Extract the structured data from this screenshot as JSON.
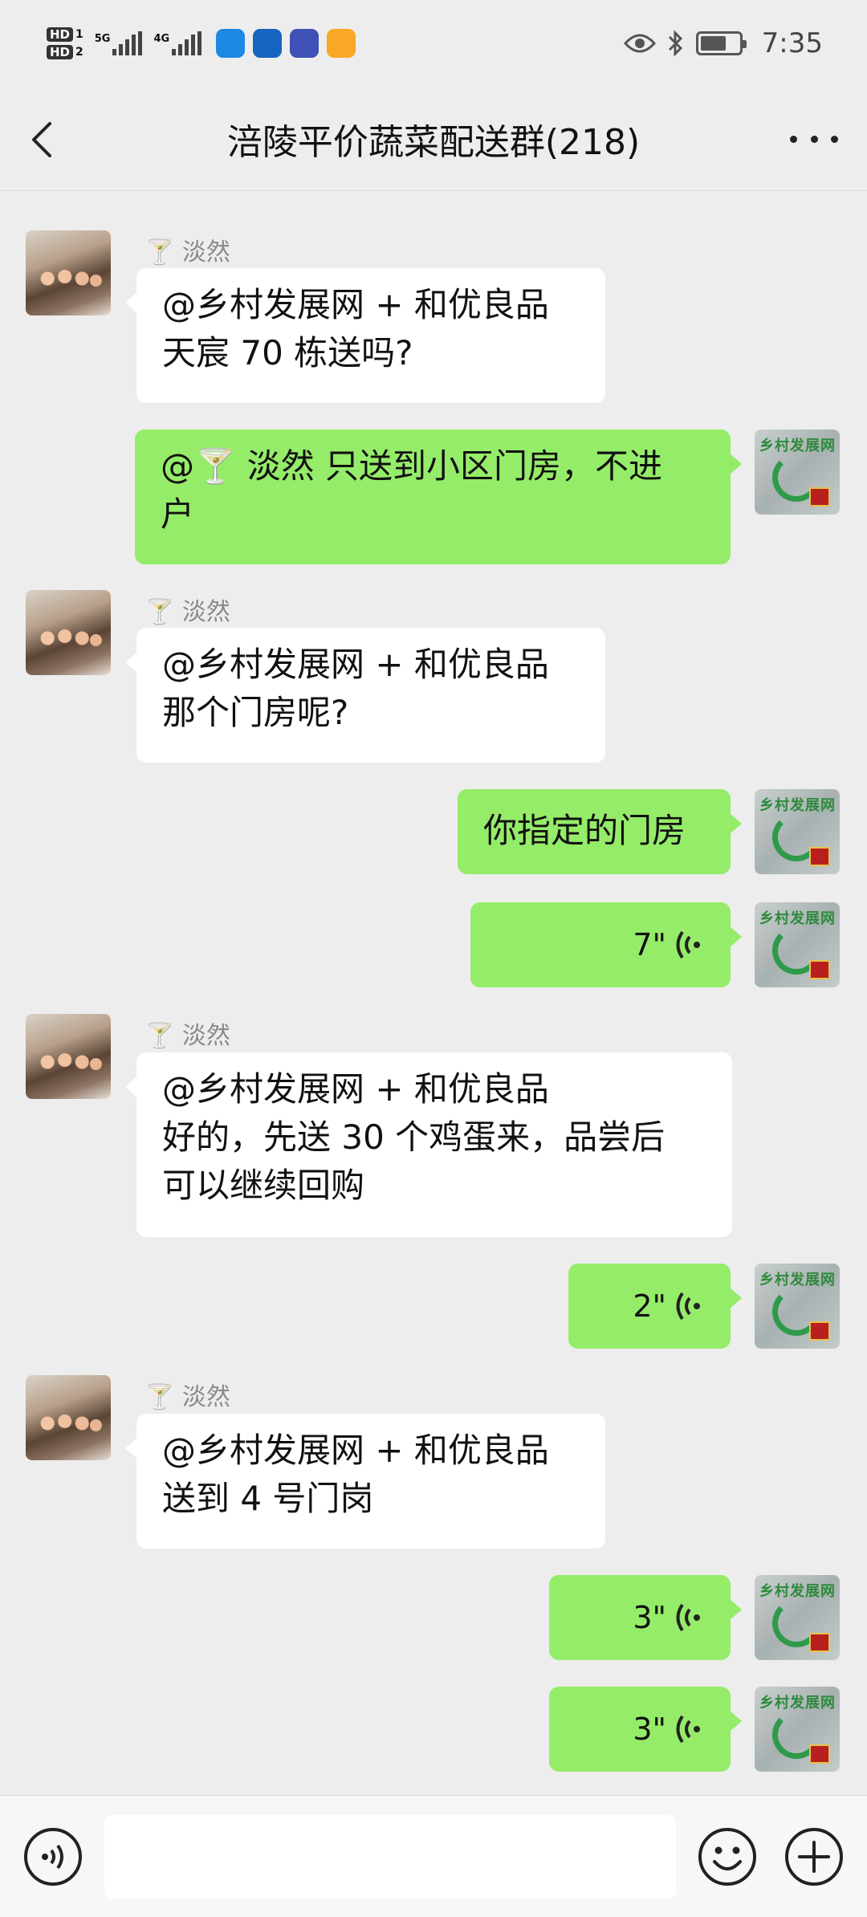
{
  "status_bar": {
    "hd1": "HD",
    "hd1_num": "1",
    "hd2": "HD",
    "hd2_num": "2",
    "net1": "5G",
    "net2": "4G",
    "time": "7:35"
  },
  "header": {
    "title": "涪陵平价蔬菜配送群(218)"
  },
  "avatars": {
    "logo_text": "乡村发展网"
  },
  "messages": [
    {
      "dir": "in",
      "sender": "🍸 淡然",
      "lines": [
        "@乡村发展网 + 和优良品",
        "天宸 70 栋送吗?"
      ]
    },
    {
      "dir": "out",
      "lines": [
        "@🍸 淡然  只送到小区门房，不进",
        "户"
      ]
    },
    {
      "dir": "in",
      "sender": "🍸 淡然",
      "lines": [
        "@乡村发展网 + 和优良品",
        "那个门房呢?"
      ]
    },
    {
      "dir": "out",
      "lines": [
        "你指定的门房"
      ]
    },
    {
      "dir": "out",
      "voice": "7\""
    },
    {
      "dir": "in",
      "sender": "🍸 淡然",
      "lines": [
        "@乡村发展网 + 和优良品",
        "好的，先送 30 个鸡蛋来，品尝后",
        "可以继续回购"
      ]
    },
    {
      "dir": "out",
      "voice": "2\""
    },
    {
      "dir": "in",
      "sender": "🍸 淡然",
      "lines": [
        "@乡村发展网 + 和优良品",
        "送到 4 号门岗"
      ]
    },
    {
      "dir": "out",
      "voice": "3\""
    },
    {
      "dir": "out",
      "voice": "3\""
    }
  ],
  "input": {
    "value": ""
  }
}
